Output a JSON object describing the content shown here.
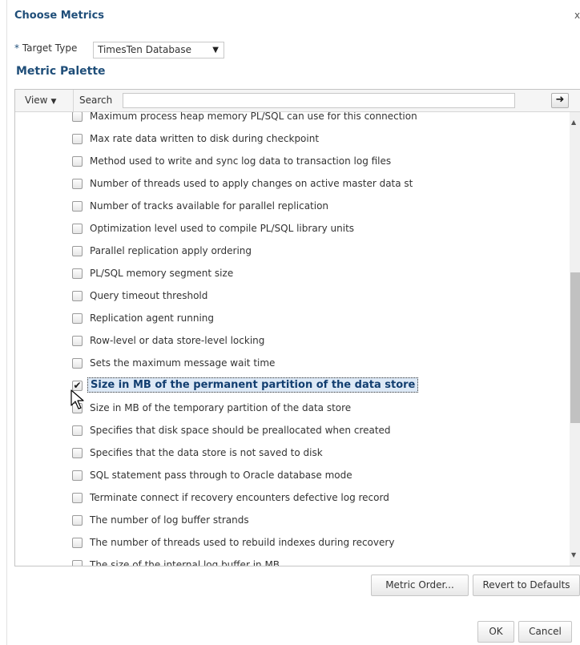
{
  "dialog": {
    "title": "Choose Metrics",
    "close": "x"
  },
  "target_type": {
    "required_marker": "*",
    "label": "Target Type",
    "value": "TimesTen Database"
  },
  "palette": {
    "title": "Metric Palette",
    "view_label": "View",
    "search_label": "Search",
    "search_value": "",
    "go_icon": "arrow-right"
  },
  "metrics": [
    {
      "label": "Maximum process heap memory PL/SQL can use for this connection",
      "checked": false
    },
    {
      "label": "Max rate data written to disk during checkpoint",
      "checked": false
    },
    {
      "label": "Method used to write and sync log data to transaction log files",
      "checked": false
    },
    {
      "label": "Number of threads used to apply changes on active master data st",
      "checked": false
    },
    {
      "label": "Number of tracks available for parallel replication",
      "checked": false
    },
    {
      "label": "Optimization level used to compile PL/SQL library units",
      "checked": false
    },
    {
      "label": "Parallel replication apply ordering",
      "checked": false
    },
    {
      "label": "PL/SQL memory segment size",
      "checked": false
    },
    {
      "label": "Query timeout threshold",
      "checked": false
    },
    {
      "label": "Replication agent running",
      "checked": false
    },
    {
      "label": "Row-level or data store-level locking",
      "checked": false
    },
    {
      "label": "Sets the maximum message wait time",
      "checked": false
    },
    {
      "label": "Size in MB of the permanent partition of the data store",
      "checked": true
    },
    {
      "label": "Size in MB of the temporary partition of the data store",
      "checked": false
    },
    {
      "label": "Specifies that disk space should be preallocated when created",
      "checked": false
    },
    {
      "label": "Specifies that the data store is not saved to disk",
      "checked": false
    },
    {
      "label": "SQL statement pass through to Oracle database mode",
      "checked": false
    },
    {
      "label": "Terminate connect if recovery encounters defective log record",
      "checked": false
    },
    {
      "label": "The number of log buffer strands",
      "checked": false
    },
    {
      "label": "The number of threads used to rebuild indexes during recovery",
      "checked": false
    },
    {
      "label": "The size of the internal log buffer in MB",
      "checked": false
    }
  ],
  "buttons": {
    "metric_order": "Metric Order...",
    "revert": "Revert to Defaults",
    "ok": "OK",
    "cancel": "Cancel"
  },
  "colors": {
    "heading": "#1f4e79",
    "selection": "#dde9f6"
  }
}
